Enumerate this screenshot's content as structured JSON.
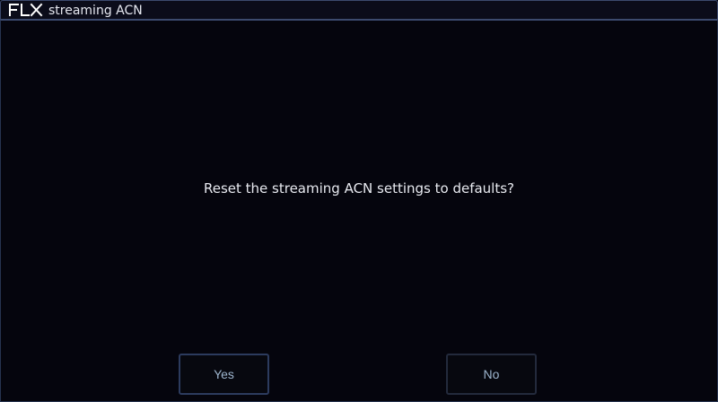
{
  "window": {
    "logo_text": "FLX",
    "title": "streaming ACN"
  },
  "dialog": {
    "message": "Reset the streaming ACN settings to defaults?",
    "yes_label": "Yes",
    "no_label": "No"
  },
  "colors": {
    "background": "#05050d",
    "border": "#3c4a6e",
    "text": "#e8eaf0",
    "button_text": "#9eb6cf"
  },
  "icons": {
    "logo": "flx-logo-icon"
  }
}
